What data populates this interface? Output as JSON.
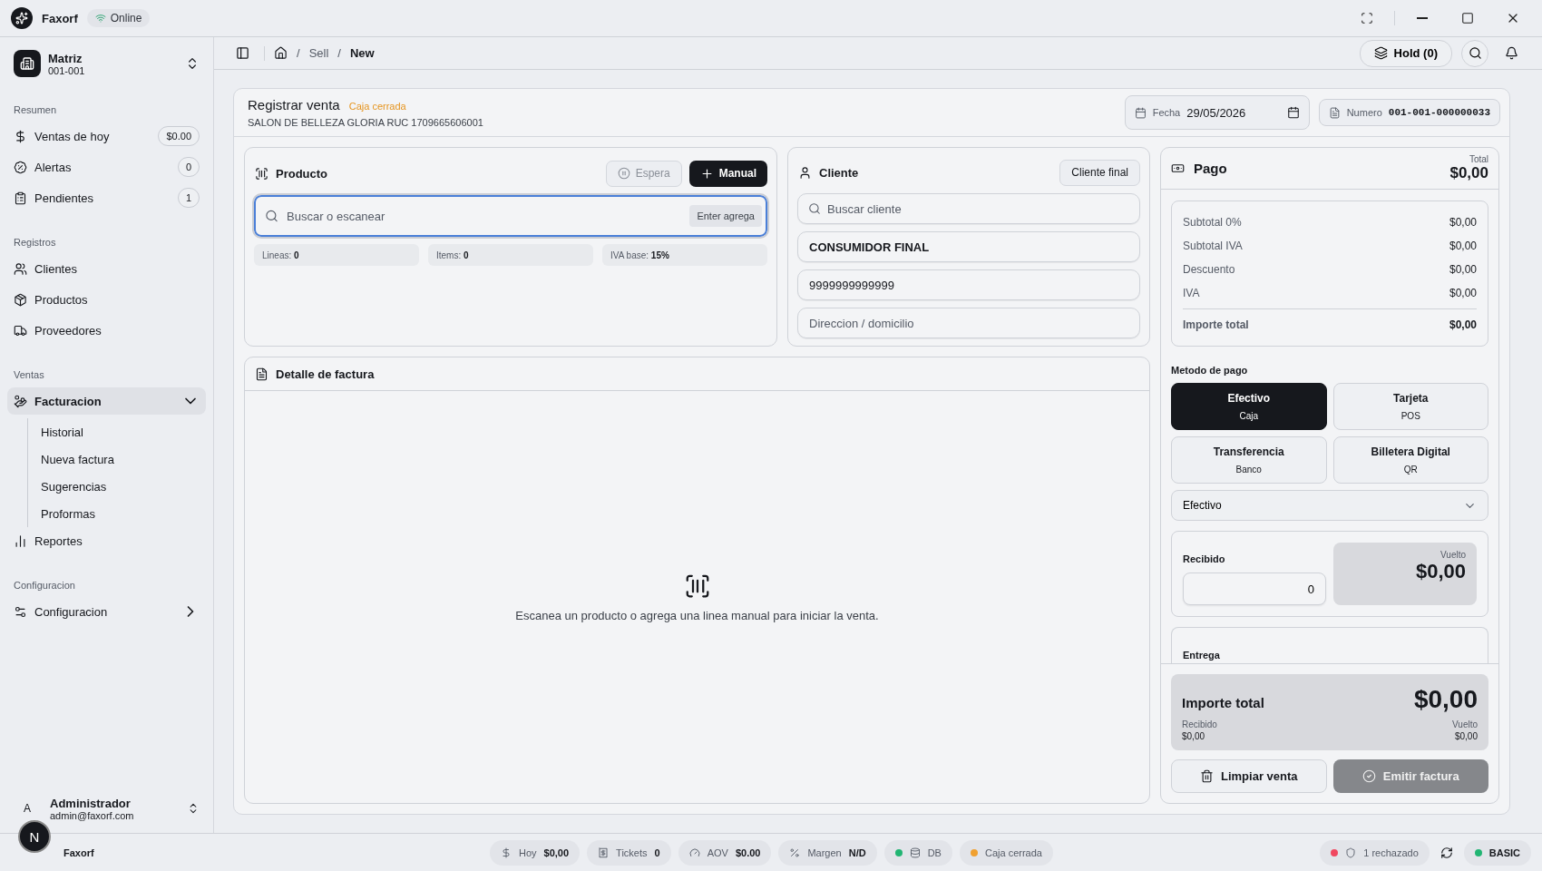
{
  "titlebar": {
    "app": "Faxorf",
    "status": "Online"
  },
  "sidebar": {
    "branch": {
      "name": "Matriz",
      "code": "001-001"
    },
    "sections": [
      {
        "title": "Resumen",
        "items": [
          {
            "label": "Ventas de hoy",
            "badge": "$0.00",
            "selected": false
          },
          {
            "label": "Alertas",
            "badge": "0",
            "selected": false
          },
          {
            "label": "Pendientes",
            "badge": "1",
            "selected": false
          }
        ]
      },
      {
        "title": "Registros",
        "items": [
          {
            "label": "Clientes",
            "selected": false
          },
          {
            "label": "Productos",
            "selected": false
          },
          {
            "label": "Proveedores",
            "selected": false
          }
        ]
      },
      {
        "title": "Ventas",
        "items": [
          {
            "label": "Facturacion",
            "selected": true,
            "expanded": true,
            "children": [
              {
                "label": "Historial"
              },
              {
                "label": "Nueva factura"
              },
              {
                "label": "Sugerencias"
              },
              {
                "label": "Proformas"
              }
            ]
          },
          {
            "label": "Reportes",
            "selected": false
          }
        ]
      },
      {
        "title": "Configuracion",
        "items": [
          {
            "label": "Configuracion",
            "selected": false,
            "expanded": false
          }
        ]
      }
    ],
    "user": {
      "initial": "A",
      "name": "Administrador",
      "email": "admin@faxorf.com"
    }
  },
  "breadcrumb": {
    "separator": "/",
    "items": [
      "Sell",
      "New"
    ]
  },
  "hold_button": "Hold (0)",
  "sale": {
    "title": "Registrar venta",
    "status": "Caja cerrada",
    "company": "SALON DE BELLEZA GLORIA RUC 1709665606001",
    "date": {
      "label": "Fecha",
      "value": "29/05/2026"
    },
    "number": {
      "label": "Numero",
      "value": "001-001-000000033"
    }
  },
  "product": {
    "title": "Producto",
    "hold": {
      "label": "Espera",
      "disabled": true
    },
    "manual": "Manual",
    "search_placeholder": "Buscar o escanear",
    "search_hint": "Enter agrega",
    "stats": [
      {
        "label": "Lineas:",
        "value": "0"
      },
      {
        "label": "Items:",
        "value": "0"
      },
      {
        "label": "IVA base:",
        "value": "15%"
      }
    ]
  },
  "client": {
    "title": "Cliente",
    "final_button": "Cliente final",
    "search_placeholder": "Buscar cliente",
    "name": "CONSUMIDOR FINAL",
    "id": "9999999999999",
    "address_placeholder": "Direccion / domicilio"
  },
  "detail": {
    "title": "Detalle de factura",
    "empty": "Escanea un producto o agrega una linea manual para iniciar la venta."
  },
  "payment": {
    "title": "Pago",
    "total_label": "Total",
    "total": "$0,00",
    "lines": [
      {
        "label": "Subtotal 0%",
        "value": "$0,00"
      },
      {
        "label": "Subtotal IVA",
        "value": "$0,00"
      },
      {
        "label": "Descuento",
        "value": "$0,00"
      },
      {
        "label": "IVA",
        "value": "$0,00"
      }
    ],
    "grand": {
      "label": "Importe total",
      "value": "$0,00"
    },
    "method_label": "Metodo de pago",
    "methods": [
      {
        "name": "Efectivo",
        "sub": "Caja",
        "selected": true
      },
      {
        "name": "Tarjeta",
        "sub": "POS",
        "selected": false
      },
      {
        "name": "Transferencia",
        "sub": "Banco",
        "selected": false
      },
      {
        "name": "Billetera Digital",
        "sub": "QR",
        "selected": false
      }
    ],
    "method_select": "Efectivo",
    "received_label": "Recibido",
    "received_value": "0",
    "change_label": "Vuelto",
    "change_value": "$0,00",
    "delivery_label": "Entrega",
    "summary": {
      "label": "Importe total",
      "value": "$0,00",
      "received_label": "Recibido",
      "received": "$0,00",
      "change_label": "Vuelto",
      "change": "$0,00"
    },
    "clear_button": "Limpiar venta",
    "emit_button": {
      "label": "Emitir factura",
      "disabled": true
    }
  },
  "statusbar": {
    "app": "Faxorf",
    "avatar": "N",
    "stats": [
      {
        "label": "Hoy",
        "value": "$0,00"
      },
      {
        "label": "Tickets",
        "value": "0"
      },
      {
        "label": "AOV",
        "value": "$0.00"
      },
      {
        "label": "Margen",
        "value": "N/D"
      }
    ],
    "indicators": [
      {
        "label": "DB",
        "color": "#22b573"
      },
      {
        "label": "Caja cerrada",
        "color": "#f0a030"
      }
    ],
    "right": [
      {
        "label": "1 rechazado",
        "color": "#f04860"
      },
      {
        "label": "BASIC",
        "color": "#22b573"
      }
    ]
  }
}
